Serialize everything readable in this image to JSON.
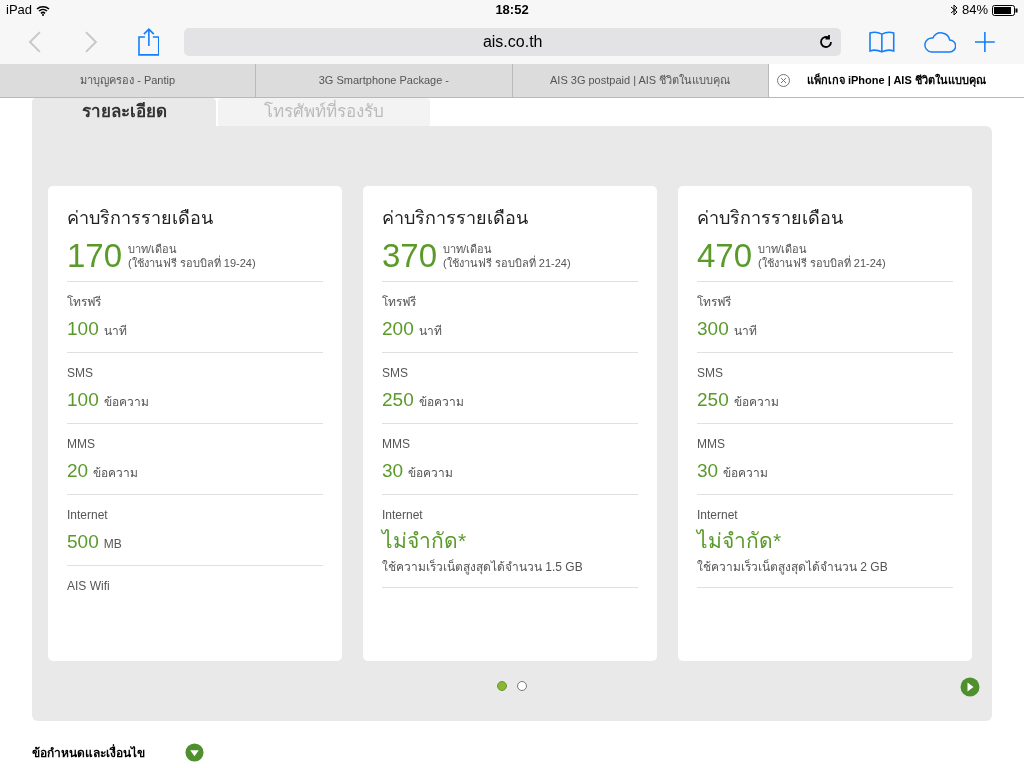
{
  "status_bar": {
    "device": "iPad",
    "time": "18:52",
    "battery": "84%"
  },
  "toolbar": {
    "url": "ais.co.th"
  },
  "browser_tabs": [
    {
      "title": "มาบุญครอง - Pantip",
      "selected": false
    },
    {
      "title": "3G Smartphone Package -",
      "selected": false
    },
    {
      "title": "AIS 3G postpaid | AIS ชีวิตในแบบคุณ",
      "selected": false
    },
    {
      "title": "แพ็กเกจ iPhone | AIS ชีวิตในแบบคุณ",
      "selected": true
    }
  ],
  "page_tabs": [
    {
      "label": "รายละเอียด",
      "selected": true
    },
    {
      "label": "โทรศัพท์ที่รองรับ",
      "selected": false
    }
  ],
  "cards": [
    {
      "title": "ค่าบริการรายเดือน",
      "price": "170",
      "price_unit": "บาท/เดือน",
      "price_note": "(ใช้งานฟรี รอบบิลที่ 19-24)",
      "rows": [
        {
          "kind": "amount",
          "label": "โทรฟรี",
          "value": "100",
          "unit": "นาที"
        },
        {
          "kind": "amount",
          "label": "SMS",
          "value": "100",
          "unit": "ข้อความ"
        },
        {
          "kind": "amount",
          "label": "MMS",
          "value": "20",
          "unit": "ข้อความ"
        },
        {
          "kind": "amount",
          "label": "Internet",
          "value": "500",
          "unit": "MB"
        },
        {
          "kind": "label",
          "label": "AIS Wifi"
        }
      ]
    },
    {
      "title": "ค่าบริการรายเดือน",
      "price": "370",
      "price_unit": "บาท/เดือน",
      "price_note": "(ใช้งานฟรี รอบบิลที่ 21-24)",
      "rows": [
        {
          "kind": "amount",
          "label": "โทรฟรี",
          "value": "200",
          "unit": "นาที"
        },
        {
          "kind": "amount",
          "label": "SMS",
          "value": "250",
          "unit": "ข้อความ"
        },
        {
          "kind": "amount",
          "label": "MMS",
          "value": "30",
          "unit": "ข้อความ"
        },
        {
          "kind": "unlimited",
          "label": "Internet",
          "value": "ไม่จำกัด*",
          "note": "ใช้ความเร็วเน็ตสูงสุดได้จำนวน 1.5 GB"
        }
      ]
    },
    {
      "title": "ค่าบริการรายเดือน",
      "price": "470",
      "price_unit": "บาท/เดือน",
      "price_note": "(ใช้งานฟรี รอบบิลที่ 21-24)",
      "rows": [
        {
          "kind": "amount",
          "label": "โทรฟรี",
          "value": "300",
          "unit": "นาที"
        },
        {
          "kind": "amount",
          "label": "SMS",
          "value": "250",
          "unit": "ข้อความ"
        },
        {
          "kind": "amount",
          "label": "MMS",
          "value": "30",
          "unit": "ข้อความ"
        },
        {
          "kind": "unlimited",
          "label": "Internet",
          "value": "ไม่จำกัด*",
          "note": "ใช้ความเร็วเน็ตสูงสุดได้จำนวน 2 GB"
        }
      ]
    }
  ],
  "pager": [
    {
      "selected": true
    },
    {
      "selected": false
    }
  ],
  "terms": {
    "label": "ข้อกำหนดและเงื่อนไข"
  }
}
